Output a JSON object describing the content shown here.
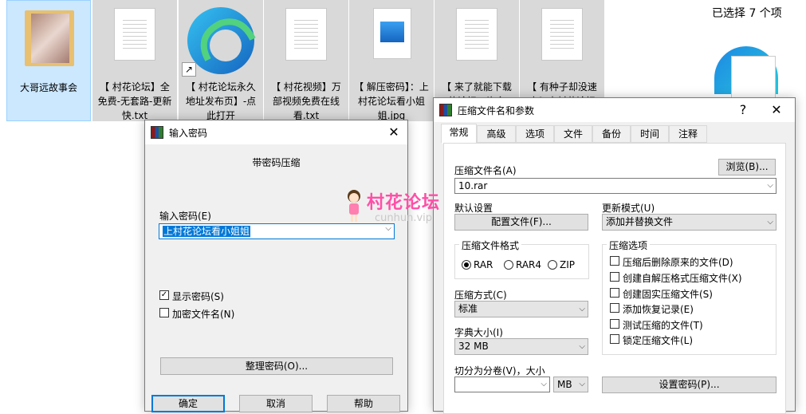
{
  "explorer": {
    "selected_count": "已选择 7 个项",
    "files": [
      {
        "label": "大哥远故事会",
        "type": "folder"
      },
      {
        "label": "【 村花论坛】全免费-无套路-更新快.txt",
        "type": "txt"
      },
      {
        "label": "【 村花论坛永久地址发布页】-点此打开",
        "type": "shortcut"
      },
      {
        "label": "【 村花视频】万部视频免费在线看.txt",
        "type": "txt"
      },
      {
        "label": "【 解压密码】：上村花论坛看小姐姐.jpg",
        "type": "jpg"
      },
      {
        "label": "【 来了就能下载的论坛，许多",
        "type": "txt"
      },
      {
        "label": "【 有种子却没速度？来村花论坛",
        "type": "txt"
      }
    ]
  },
  "password_dialog": {
    "title": "输入密码",
    "heading": "带密码压缩",
    "password_label": "输入密码(E)",
    "password_value": "上村花论坛看小姐姐",
    "show_password": "显示密码(S)",
    "encrypt_filenames": "加密文件名(N)",
    "organize_button": "整理密码(O)...",
    "ok_button": "确定",
    "cancel_button": "取消",
    "help_button": "帮助"
  },
  "archive_dialog": {
    "title": "压缩文件名和参数",
    "help_glyph": "?",
    "tabs": [
      "常规",
      "高级",
      "选项",
      "文件",
      "备份",
      "时间",
      "注释"
    ],
    "archive_name_label": "压缩文件名(A)",
    "browse_button": "浏览(B)...",
    "archive_name_value": "10.rar",
    "default_settings_label": "默认设置",
    "profiles_button": "配置文件(F)...",
    "update_mode_label": "更新模式(U)",
    "update_mode_value": "添加并替换文件",
    "format_group": "压缩文件格式",
    "formats": [
      "RAR",
      "RAR4",
      "ZIP"
    ],
    "method_label": "压缩方式(C)",
    "method_value": "标准",
    "dict_label": "字典大小(I)",
    "dict_value": "32 MB",
    "split_label": "切分为分卷(V)，大小",
    "split_value": "",
    "split_unit": "MB",
    "options_group": "压缩选项",
    "options": [
      "压缩后删除原来的文件(D)",
      "创建自解压格式压缩文件(X)",
      "创建固实压缩文件(S)",
      "添加恢复记录(E)",
      "测试压缩的文件(T)",
      "锁定压缩文件(L)"
    ],
    "set_password_button": "设置密码(P)..."
  },
  "watermark": {
    "text": "村花论坛",
    "sub": "cunhun.vip"
  }
}
